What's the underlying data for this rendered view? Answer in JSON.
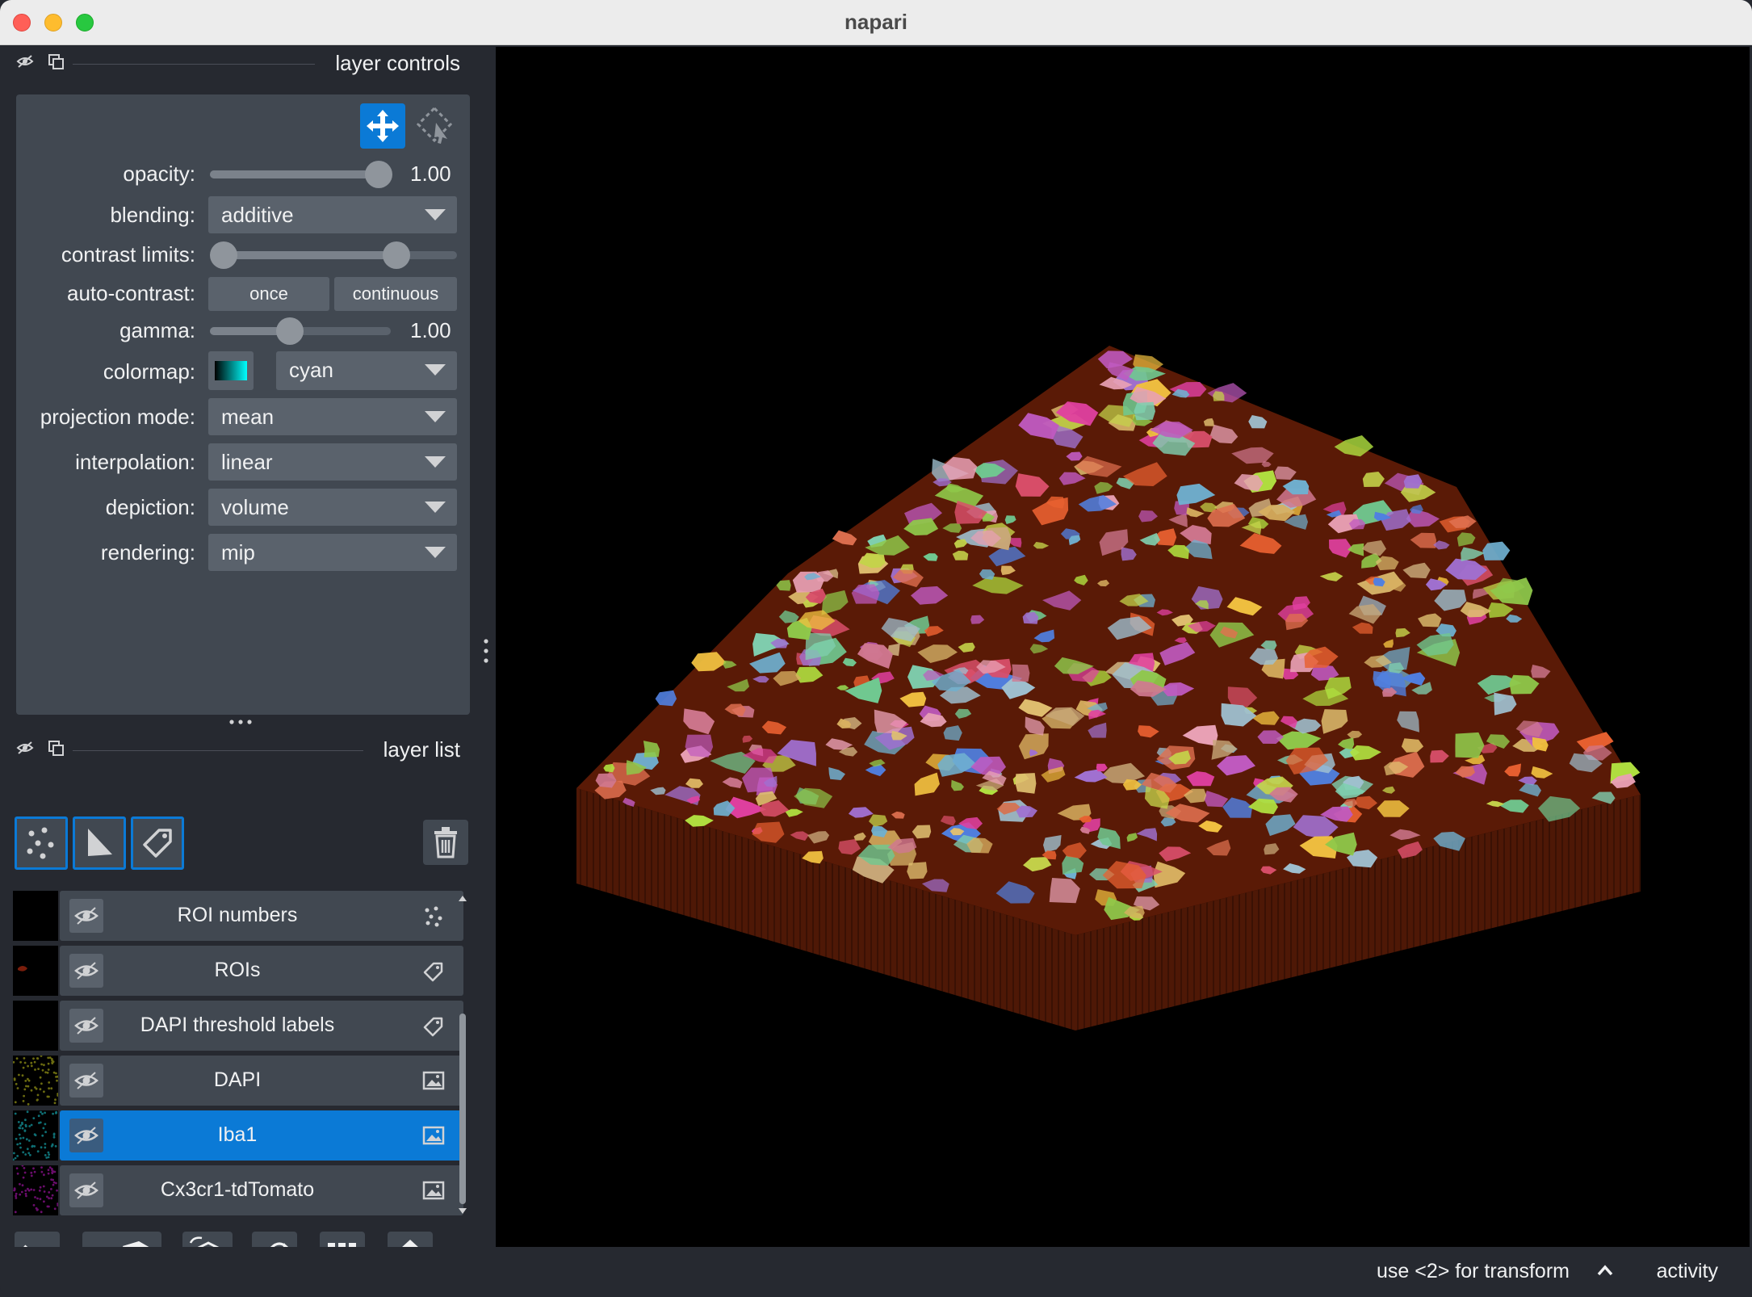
{
  "window": {
    "title": "napari"
  },
  "layer_controls": {
    "title": "layer controls",
    "opacity": {
      "label": "opacity:",
      "value": "1.00",
      "level": 1.0
    },
    "blending": {
      "label": "blending:",
      "value": "additive"
    },
    "contrast_limits": {
      "label": "contrast limits:",
      "low": 0.0,
      "high": 0.85
    },
    "auto_contrast": {
      "label": "auto-contrast:",
      "once": "once",
      "continuous": "continuous"
    },
    "gamma": {
      "label": "gamma:",
      "value": "1.00",
      "level": 0.5
    },
    "colormap": {
      "label": "colormap:",
      "value": "cyan",
      "color": "#00ffff"
    },
    "projection_mode": {
      "label": "projection mode:",
      "value": "mean"
    },
    "interpolation": {
      "label": "interpolation:",
      "value": "linear"
    },
    "depiction": {
      "label": "depiction:",
      "value": "volume"
    },
    "rendering": {
      "label": "rendering:",
      "value": "mip"
    }
  },
  "layer_list": {
    "title": "layer list",
    "layers": [
      {
        "name": "ROI numbers",
        "type": "points-icon",
        "thumb": "#000000",
        "selected": false
      },
      {
        "name": "ROIs",
        "type": "labels-icon",
        "thumb": "#000000",
        "selected": false
      },
      {
        "name": "DAPI threshold labels",
        "type": "labels-icon",
        "thumb": "#000000",
        "selected": false
      },
      {
        "name": "DAPI",
        "type": "image-icon",
        "thumb": "#6b6b10",
        "selected": false
      },
      {
        "name": "Iba1",
        "type": "image-icon",
        "thumb": "#0f6f74",
        "selected": true
      },
      {
        "name": "Cx3cr1-tdTomato",
        "type": "image-icon",
        "thumb": "#6a0d6c",
        "selected": false
      }
    ]
  },
  "status": {
    "message": "use <2> for transform",
    "activity": "activity"
  },
  "colors": {
    "accent": "#0b7ad6",
    "panel": "#262930",
    "box": "#414851",
    "volume": "#5a1a06"
  }
}
